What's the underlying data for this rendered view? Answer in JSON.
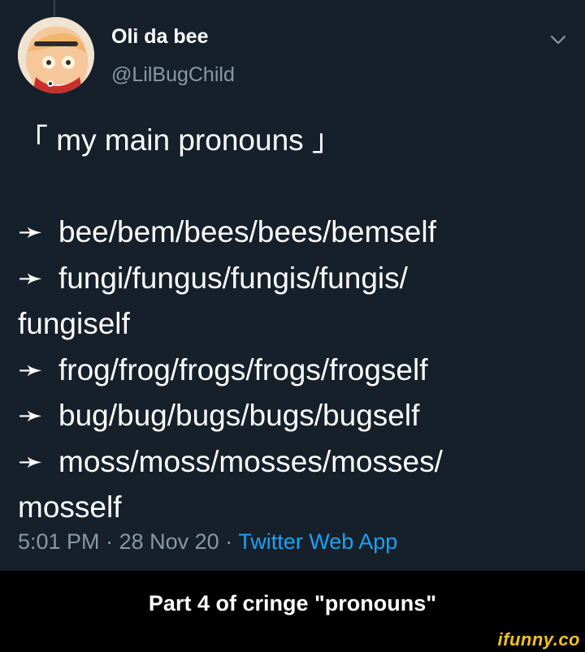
{
  "tweet": {
    "author": {
      "name": "Oli da bee",
      "handle": "@LilBugChild"
    },
    "text": {
      "heading": "「 my main pronouns 」",
      "arrow": "➛",
      "lines": [
        "bee/bem/bees/bees/bemself",
        "fungi/fungus/fungis/fungis/",
        "fungiself",
        "frog/frog/frogs/frogs/frogself",
        "bug/bug/bugs/bugs/bugself",
        "moss/moss/mosses/mosses/",
        "mosself"
      ]
    },
    "meta": {
      "time": "5:01 PM",
      "separator": "·",
      "date": "28 Nov 20",
      "source": "Twitter Web App"
    }
  },
  "caption": "Part 4 of cringe \"pronouns\"",
  "watermark": "ifunny.co",
  "colors": {
    "background": "#15202b",
    "secondary_text": "#8899a6",
    "link": "#1da1f2",
    "watermark": "#f4c21a"
  },
  "icons": {
    "menu": "chevron-down-icon"
  }
}
